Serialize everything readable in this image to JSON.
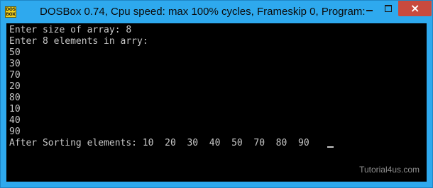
{
  "window": {
    "title": "DOSBox 0.74, Cpu speed: max 100% cycles, Frameskip  0, Program:",
    "icon_text": "DOS BOX",
    "buttons": {
      "minimize": "minimize-icon",
      "maximize": "maximize-icon",
      "close": "×"
    }
  },
  "console": {
    "lines": [
      "Enter size of array: 8",
      "Enter 8 elements in arry:",
      "50",
      "30",
      "70",
      "20",
      "80",
      "10",
      "40",
      "90",
      "After Sorting elements: 10  20  30  40  50  70  80  90"
    ],
    "watermark": "Tutorial4us.com"
  },
  "colors": {
    "titlebar": "#2ea9ee",
    "close_button": "#c84a3e",
    "console_bg": "#000000",
    "console_text": "#c8c8c8"
  }
}
